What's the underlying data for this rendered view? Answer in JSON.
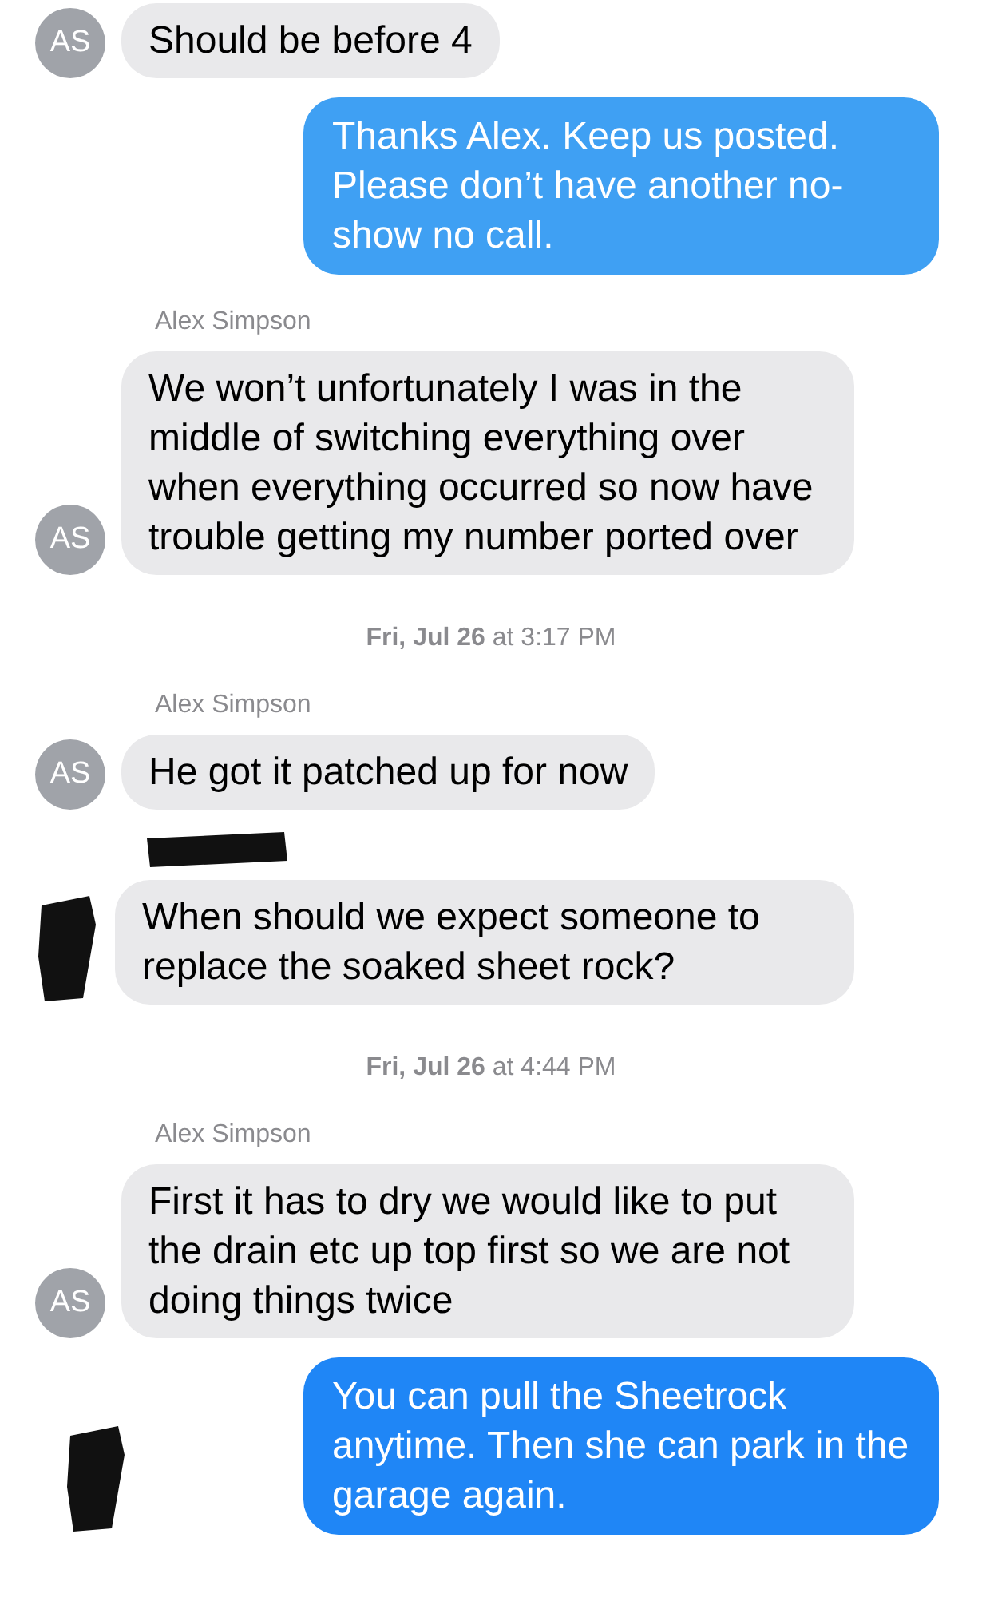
{
  "messages": [
    {
      "kind": "incoming",
      "avatar": {
        "kind": "initials",
        "text": "AS"
      },
      "text": "Should be before 4"
    },
    {
      "kind": "outgoing",
      "color": "#3fa0f3",
      "text": "Thanks Alex. Keep us posted. Please don’t have another no-show no call."
    },
    {
      "kind": "sender",
      "text": "Alex Simpson"
    },
    {
      "kind": "incoming",
      "avatar": {
        "kind": "initials",
        "text": "AS"
      },
      "text": "We won’t unfortunately I was in the middle of switching everything over when everything occurred so now have trouble getting my number ported over"
    },
    {
      "kind": "timestamp",
      "text": "**Fri, Jul 26** at 3:17 PM"
    },
    {
      "kind": "sender",
      "text": "Alex Simpson"
    },
    {
      "kind": "incoming",
      "avatar": {
        "kind": "initials",
        "text": "AS"
      },
      "text": "He got it patched up for now"
    },
    {
      "kind": "redacted"
    },
    {
      "kind": "incoming",
      "avatar": {
        "kind": "redacted"
      },
      "text": "When should we expect someone to replace the soaked sheet rock?"
    },
    {
      "kind": "timestamp",
      "text": "**Fri, Jul 26** at 4:44 PM"
    },
    {
      "kind": "sender",
      "text": "Alex Simpson"
    },
    {
      "kind": "incoming",
      "avatar": {
        "kind": "initials",
        "text": "AS"
      },
      "text": "First it has to dry we would  like to put the drain etc up top first so we are not doing things twice"
    },
    {
      "kind": "outgoing",
      "color": "#1f86f6",
      "avatar": {
        "kind": "redacted"
      },
      "text": "You can pull the Sheetrock anytime. Then she can park in the garage again."
    }
  ]
}
